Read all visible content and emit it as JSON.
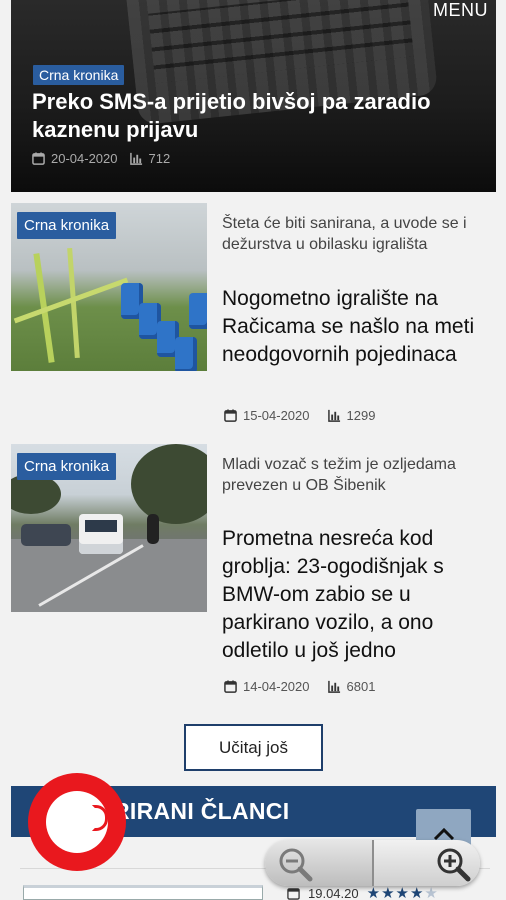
{
  "header": {
    "menu_label": "MENU"
  },
  "hero": {
    "category": "Crna kronika",
    "title": "Preko SMS-a prijetio bivšoj pa zaradio kaznenu prijavu",
    "date": "20-04-2020",
    "views": "712"
  },
  "articles": [
    {
      "category": "Crna kronika",
      "kicker": "Šteta će biti sanirana, a uvode se i dežurstva u obilasku igrališta",
      "title": "Nogometno igralište na Račicama se našlo na meti neodgovornih pojedinaca",
      "date": "15-04-2020",
      "views": "1299"
    },
    {
      "category": "Crna kronika",
      "kicker": "Mladi vozač s težim je ozljedama prevezen u OB Šibenik",
      "title": "Prometna nesreća kod groblja: 23-ogodišnjak s BMW-om zabio se u parkirano vozilo, a ono odletilo u još jedno",
      "date": "14-04-2020",
      "views": "6801"
    }
  ],
  "load_more_label": "Učitaj još",
  "section": {
    "title": "RIRANI ČLANCI"
  },
  "bottom_item": {
    "date": "19.04.20",
    "rating": 4,
    "rating_max": 5
  },
  "colors": {
    "accent": "#1f4676",
    "badge": "#2a5d9f",
    "a11y": "#e9181e"
  },
  "icons": [
    "calendar-icon",
    "bar-chart-icon",
    "chevron-up-icon",
    "zoom-out-icon",
    "zoom-in-icon",
    "hearing-icon"
  ]
}
